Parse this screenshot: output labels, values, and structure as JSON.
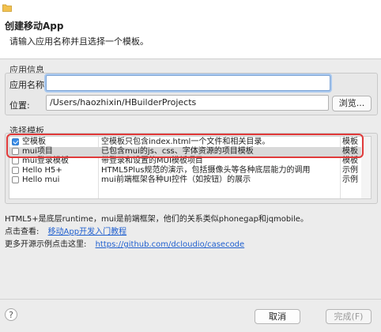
{
  "header": {
    "title": "创建移动App",
    "description": "请输入应用名称并且选择一个模板。"
  },
  "app_info": {
    "group_title": "应用信息",
    "name_label": "应用名称:",
    "name_value": "",
    "location_label": "位置:",
    "location_value": "/Users/haozhixin/HBuilderProjects",
    "browse_label": "浏览..."
  },
  "templates": {
    "group_title": "选择模板",
    "rows": [
      {
        "name": "空模板",
        "desc": "空模板只包含index.html一个文件和相关目录。",
        "category": "模板",
        "checked": true
      },
      {
        "name": "mui项目",
        "desc": "已包含mui的js、css、字体资源的项目模板",
        "category": "模板",
        "checked": false
      },
      {
        "name": "mui登录模板",
        "desc": "带登录和设置的MUI模板项目",
        "category": "模板",
        "checked": false
      },
      {
        "name": "Hello H5+",
        "desc": "HTML5Plus规范的演示，包括摄像头等各种底层能力的调用",
        "category": "示例",
        "checked": false
      },
      {
        "name": "Hello mui",
        "desc": "mui前端框架各种UI控件（如按钮）的展示",
        "category": "示例",
        "checked": false
      }
    ]
  },
  "info": {
    "line1": "HTML5+是底层runtime，mui是前端框架，他们的关系类似phonegap和jqmobile。",
    "line2_label": "点击查看:",
    "line2_link": "移动App开发入门教程",
    "line3_label": "更多开源示例点击这里:",
    "line3_link": "https://github.com/dcloudio/casecode"
  },
  "footer": {
    "help_label": "?",
    "cancel_label": "取消",
    "finish_label": "完成(F)"
  }
}
